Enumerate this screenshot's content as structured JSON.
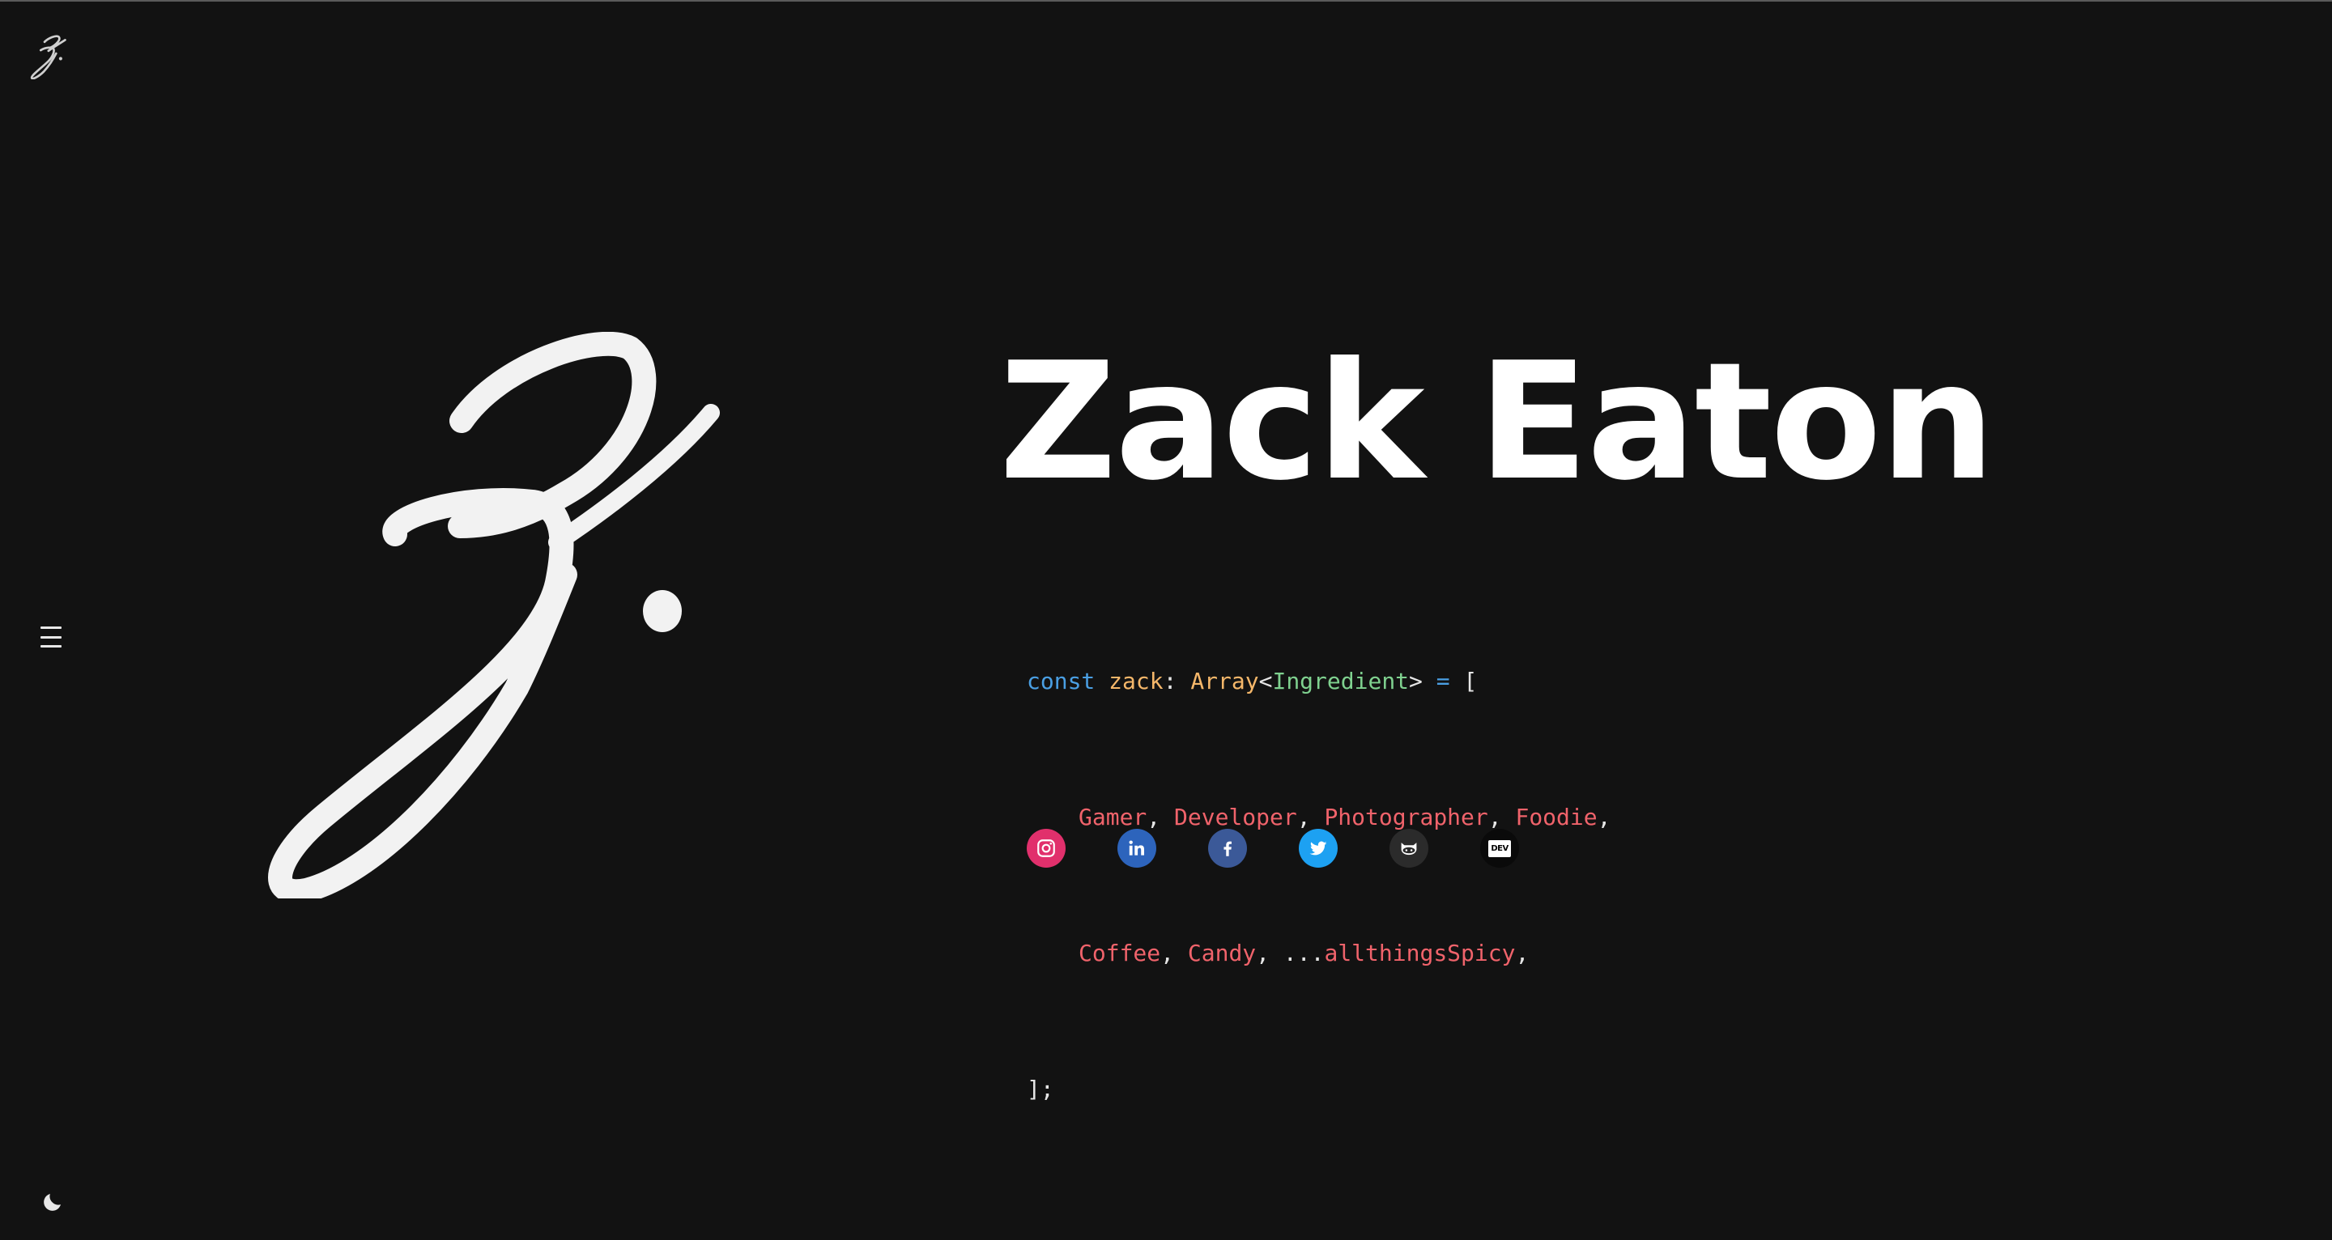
{
  "header": {
    "logo_icon": "signature-z-logo-icon"
  },
  "nav": {
    "menu_icon": "hamburger-menu-icon"
  },
  "theme": {
    "toggle_icon": "moon-icon"
  },
  "hero": {
    "logo_icon": "signature-z-logo-icon",
    "name": "Zack Eaton"
  },
  "code": {
    "keyword": "const",
    "variable": "zack",
    "colon": ":",
    "type": "Array",
    "lt": "<",
    "generic": "Ingredient",
    "gt": ">",
    "equals": "=",
    "open_bracket": "[",
    "line2": [
      "Gamer",
      "Developer",
      "Photographer",
      "Foodie"
    ],
    "line3": [
      "Coffee",
      "Candy"
    ],
    "spread": "...",
    "spread_item": "allthingsSpicy",
    "comma": ",",
    "close": "];"
  },
  "socials": [
    {
      "name": "Instagram",
      "icon": "instagram-icon",
      "color": "#e1306c"
    },
    {
      "name": "LinkedIn",
      "icon": "linkedin-icon",
      "color": "#2d64bc"
    },
    {
      "name": "Facebook",
      "icon": "facebook-icon",
      "color": "#3b5998"
    },
    {
      "name": "Twitter",
      "icon": "twitter-icon",
      "color": "#1da1f2"
    },
    {
      "name": "GitHub",
      "icon": "github-icon",
      "color": "#2b2b2b"
    },
    {
      "name": "DEV",
      "icon": "dev-icon",
      "color": "#0a0a0a",
      "label": "DEV"
    }
  ],
  "colors": {
    "background": "#121212",
    "keyword": "#4a9fe3",
    "variable": "#f5b76a",
    "generic": "#7fd18f",
    "string": "#f0636b"
  }
}
